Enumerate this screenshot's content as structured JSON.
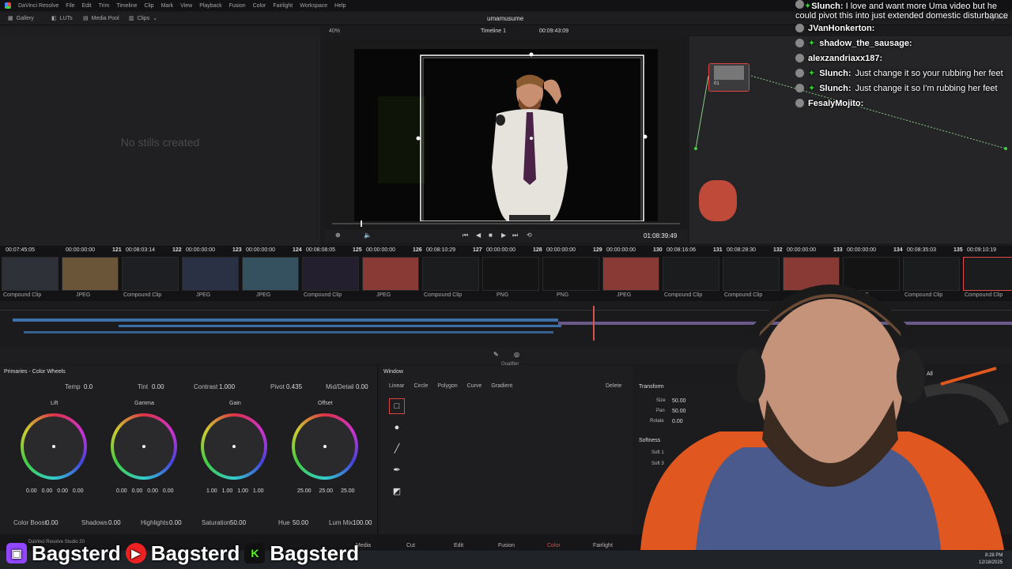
{
  "menubar": {
    "items": [
      "DaVinci Resolve",
      "File",
      "Edit",
      "Trim",
      "Timeline",
      "Clip",
      "Mark",
      "View",
      "Playback",
      "Fusion",
      "Color",
      "Fairlight",
      "Workspace",
      "Help"
    ]
  },
  "toolbar": {
    "gallery": "Gallery",
    "luts": "LUTs",
    "media_pool": "Media Pool",
    "clips": "Clips",
    "project_title": "umamusume",
    "lightbox": "Lightbox"
  },
  "gallery": {
    "empty_text": "No stills created"
  },
  "viewer": {
    "zoom": "40%",
    "timeline": "Timeline 1",
    "timecode": "00:09:43:09",
    "clip_label": "Clip",
    "duration_tc": "01:08:39:49"
  },
  "clips": [
    {
      "num": "",
      "tc": "00:07:45:05",
      "track": "V4",
      "label": "Compound Clip",
      "thumb": "#2e3238"
    },
    {
      "num": "121",
      "tc": "00:00:00:00",
      "track": "V4",
      "label": "JPEG",
      "thumb": "#6b5538"
    },
    {
      "num": "122",
      "tc": "00:08:03:14",
      "track": "V4",
      "label": "Compound Clip",
      "thumb": "#1d1f22"
    },
    {
      "num": "123",
      "tc": "00:00:00:00",
      "track": "V2",
      "label": "JPEG",
      "thumb": "#2a3145"
    },
    {
      "num": "124",
      "tc": "00:00:00:00",
      "track": "V4",
      "label": "JPEG",
      "thumb": "#35505e"
    },
    {
      "num": "125",
      "tc": "00:08:08:05",
      "track": "V4",
      "label": "Compound Clip",
      "thumb": "#241f2e"
    },
    {
      "num": "126",
      "tc": "00:00:00:00",
      "track": "V4",
      "label": "JPEG",
      "thumb": "#8a3a34"
    },
    {
      "num": "127",
      "tc": "00:08:10:29",
      "track": "V4",
      "label": "Compound Clip",
      "thumb": "#1a1c1e"
    },
    {
      "num": "128",
      "tc": "00:00:00:00",
      "track": "V4",
      "label": "PNG",
      "thumb": "#141414"
    },
    {
      "num": "129",
      "tc": "00:00:00:00",
      "track": "V4",
      "label": "PNG",
      "thumb": "#141414"
    },
    {
      "num": "130",
      "tc": "00:00:00:00",
      "track": "V4",
      "label": "JPEG",
      "thumb": "#8a3a34"
    },
    {
      "num": "131",
      "tc": "00:08:16:06",
      "track": "V4",
      "label": "Compound Clip",
      "thumb": "#1a1c1e"
    },
    {
      "num": "132",
      "tc": "00:08:28:30",
      "track": "V4",
      "label": "Compound Clip",
      "thumb": "#1a1c1e"
    },
    {
      "num": "133",
      "tc": "00:00:00:00",
      "track": "V4",
      "label": "JPEG",
      "thumb": "#8a3a34"
    },
    {
      "num": "134",
      "tc": "00:00:00:00",
      "track": "V4",
      "label": "PNG",
      "thumb": "#141414"
    },
    {
      "num": "135",
      "tc": "00:08:35:03",
      "track": "V4",
      "label": "Compound Clip",
      "thumb": "#1a1c1e"
    },
    {
      "num": "136",
      "tc": "00:09:10:19",
      "track": "V4",
      "label": "Compound Clip",
      "thumb": "#1a1c1e"
    }
  ],
  "primaries": {
    "title": "Primaries - Color Wheels",
    "temp_label": "Temp",
    "temp": "0.0",
    "tint_label": "Tint",
    "tint": "0.00",
    "contrast_label": "Contrast",
    "contrast": "1.000",
    "pivot_label": "Pivot",
    "pivot": "0.435",
    "middetail_label": "Mid/Detail",
    "middetail": "0.00",
    "wheels": [
      {
        "name": "Lift",
        "vals": [
          "0.00",
          "0.00",
          "0.00",
          "0.00"
        ]
      },
      {
        "name": "Gamma",
        "vals": [
          "0.00",
          "0.00",
          "0.00",
          "0.00"
        ]
      },
      {
        "name": "Gain",
        "vals": [
          "1.00",
          "1.00",
          "1.00",
          "1.00"
        ]
      },
      {
        "name": "Offset",
        "vals": [
          "25.00",
          "25.00",
          "25.00"
        ]
      }
    ],
    "colorboost_label": "Color Boost",
    "colorboost": "0.00",
    "shadows_label": "Shadows",
    "shadows": "0.00",
    "highlights_label": "Highlights",
    "highlights": "0.00",
    "saturation_label": "Saturation",
    "saturation": "50.00",
    "hue_label": "Hue",
    "hue": "50.00",
    "lummix_label": "Lum Mix",
    "lummix": "100.00"
  },
  "window": {
    "title": "Window",
    "tabs": [
      "Linear",
      "Circle",
      "Polygon",
      "Curve",
      "Gradient"
    ],
    "delete": "Delete",
    "qualifier_tooltip": "Qualifier"
  },
  "transform": {
    "title": "Transform",
    "size_label": "Size",
    "size": "50.00",
    "pan_label": "Pan",
    "pan": "50.00",
    "rotate_label": "Rotate",
    "rotate": "0.00",
    "softness_title": "Softness",
    "soft1": "Soft 1",
    "soft3": "Soft 3",
    "all": "All"
  },
  "node": {
    "label": "01"
  },
  "pages": [
    "Media",
    "Cut",
    "Edit",
    "Fusion",
    "Color",
    "Fairlight"
  ],
  "version_label": "DaVinci Resolve Studio 20",
  "clock": {
    "time": "8:28 PM",
    "date": "12/18/2025"
  },
  "chat": [
    {
      "user": "Slunch:",
      "msg": " I love and want more Uma video but he could pivot this into just extended domestic disturbance",
      "gem": true
    },
    {
      "user": "JVanHonkerton:",
      "msg": "",
      "gem": false
    },
    {
      "user": "shadow_the_sausage:",
      "msg": "",
      "gem": true
    },
    {
      "user": "alexzandriaxx187:",
      "msg": "",
      "gem": false
    },
    {
      "user": "Slunch:",
      "msg": " Just change it so your rubbing her feet",
      "gem": true
    },
    {
      "user": "Slunch:",
      "msg": " Just change it so I'm rubbing her feet",
      "gem": true
    },
    {
      "user": "FesalyMojito:",
      "msg": "",
      "gem": false
    }
  ],
  "brand": {
    "name1": "Bagsterd",
    "name2": "Bagsterd",
    "name3": "Bagsterd"
  },
  "colors": {
    "accent": "#e14b4b",
    "playhead": "#d9534f",
    "clip_blue": "#3d6fa8"
  }
}
